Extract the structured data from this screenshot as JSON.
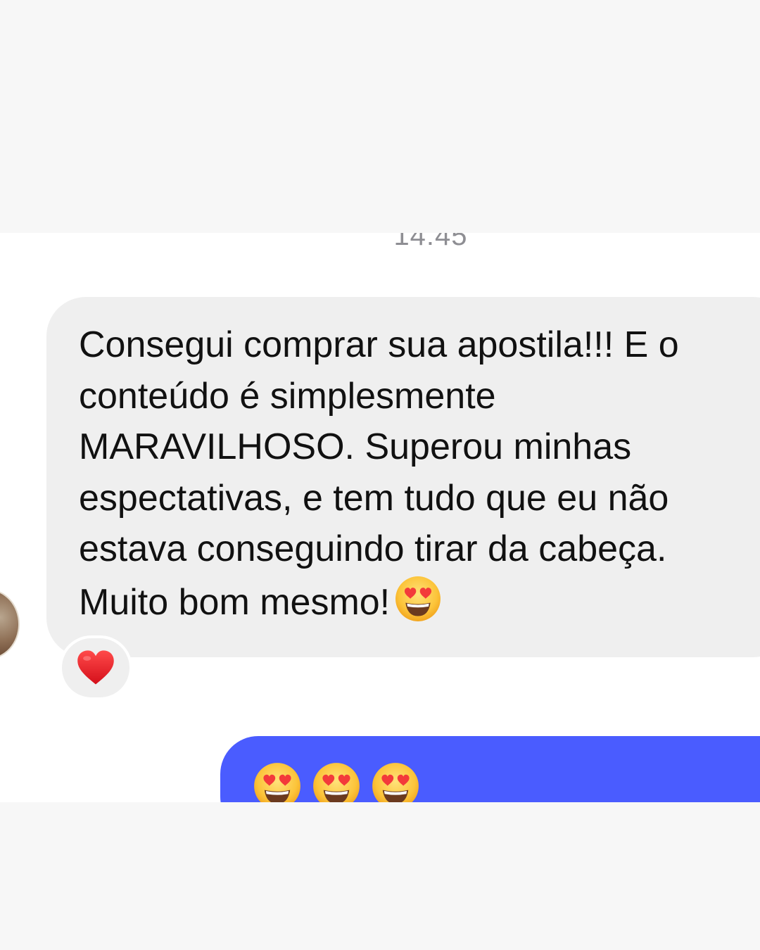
{
  "chat": {
    "timestamp": "14:45",
    "received_message": {
      "text": "Consegui comprar sua apostila!!! E o\nconteúdo é simplesmente\nMARAVILHOSO. Superou minhas\nespectativas, e tem tudo que eu não\nestava conseguindo tirar da cabeça.\nMuito bom mesmo!",
      "trailing_emoji": "smiling-face-with-heart-eyes-icon",
      "reaction": "red-heart-icon"
    },
    "sent_message": {
      "emojis": [
        "smiling-face-with-heart-eyes-icon",
        "smiling-face-with-heart-eyes-icon",
        "smiling-face-with-heart-eyes-icon"
      ]
    }
  },
  "colors": {
    "page_background": "#f7f7f7",
    "chat_background": "#ffffff",
    "received_bubble": "#efefef",
    "sent_bubble": "#4a5cff",
    "timestamp_text": "#8e8e93",
    "message_text": "#111111"
  }
}
